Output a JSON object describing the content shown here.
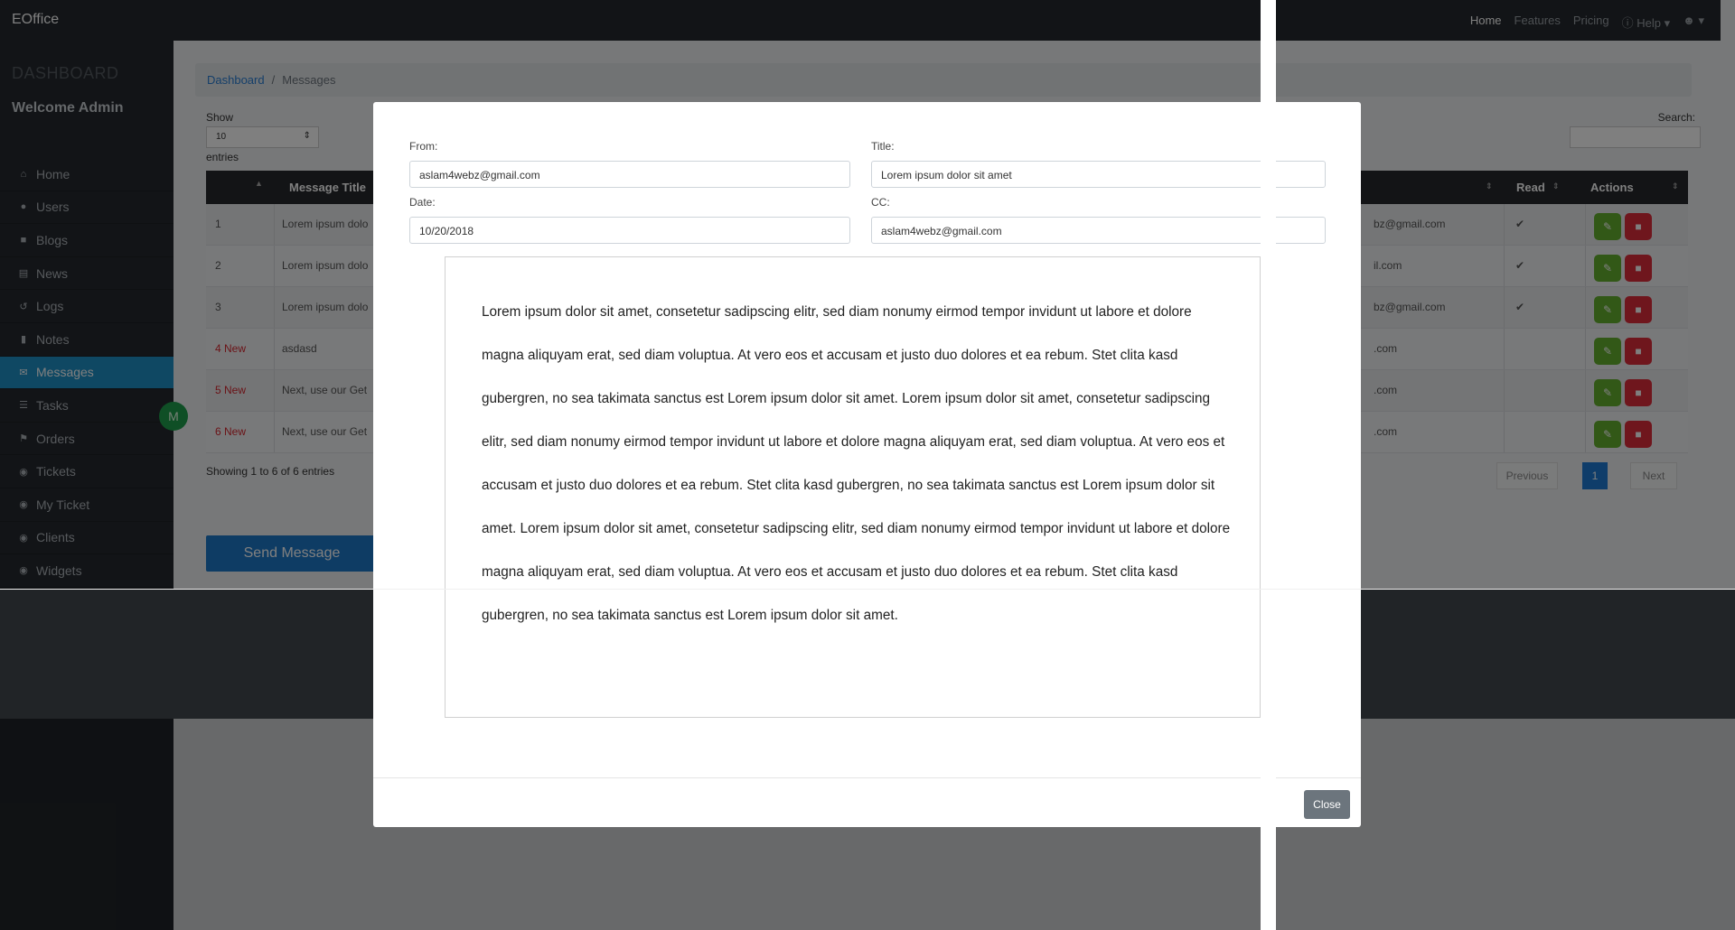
{
  "app": {
    "brand": "EOffice"
  },
  "topnav": {
    "home": "Home",
    "features": "Features",
    "pricing": "Pricing",
    "help": "Help",
    "help_caret": "▾",
    "account_caret": "▾"
  },
  "sidebar": {
    "title": "DASHBOARD",
    "welcome": "Welcome Admin",
    "items": [
      {
        "label": "Home",
        "icon": "home-icon"
      },
      {
        "label": "Users",
        "icon": "users-icon"
      },
      {
        "label": "Blogs",
        "icon": "blogs-icon"
      },
      {
        "label": "News",
        "icon": "news-icon"
      },
      {
        "label": "Logs",
        "icon": "logs-icon"
      },
      {
        "label": "Notes",
        "icon": "notes-icon"
      },
      {
        "label": "Messages",
        "icon": "messages-icon",
        "active": true
      },
      {
        "label": "Tasks",
        "icon": "tasks-icon"
      },
      {
        "label": "Orders",
        "icon": "orders-icon"
      },
      {
        "label": "Tickets",
        "icon": "tickets-icon"
      },
      {
        "label": "My Ticket",
        "icon": "my-ticket-icon"
      },
      {
        "label": "Clients",
        "icon": "clients-icon"
      },
      {
        "label": "Widgets",
        "icon": "widgets-icon"
      }
    ],
    "avatar_initial": "M"
  },
  "breadcrumb": {
    "root": "Dashboard",
    "separator": "/",
    "current": "Messages"
  },
  "table_controls": {
    "show": "Show",
    "length": "10",
    "entries": "entries",
    "search": "Search:"
  },
  "table": {
    "headers": {
      "title": "Message Title",
      "read": "Read",
      "actions": "Actions"
    },
    "rows": [
      {
        "id": "1",
        "title": "Lorem ipsum dolo",
        "email": "bz@gmail.com",
        "read": "✔"
      },
      {
        "id": "2",
        "title": "Lorem ipsum dolo",
        "email": "il.com",
        "read": "✔"
      },
      {
        "id": "3",
        "title": "Lorem ipsum dolo",
        "email": "bz@gmail.com",
        "read": "✔"
      },
      {
        "id": "4 New",
        "title": "asdasd",
        "email": ".com",
        "read": ""
      },
      {
        "id": "5 New",
        "title": "Next, use our Get",
        "email": ".com",
        "read": ""
      },
      {
        "id": "6 New",
        "title": "Next, use our Get",
        "email": ".com",
        "read": ""
      }
    ]
  },
  "table_footer": {
    "showing": "Showing 1 to 6 of 6 entries",
    "previous": "Previous",
    "page": "1",
    "next": "Next"
  },
  "send_button": "Send Message",
  "modal": {
    "from_label": "From:",
    "from_value": "aslam4webz@gmail.com",
    "title_label": "Title:",
    "title_value": "Lorem ipsum dolor sit amet",
    "date_label": "Date:",
    "date_value": "10/20/2018",
    "cc_label": "CC:",
    "cc_value": "aslam4webz@gmail.com",
    "body": "Lorem ipsum dolor sit amet, consetetur sadipscing elitr, sed diam nonumy eirmod tempor invidunt ut labore et dolore magna aliquyam erat, sed diam voluptua. At vero eos et accusam et justo duo dolores et ea rebum. Stet clita kasd gubergren, no sea takimata sanctus est Lorem ipsum dolor sit amet. Lorem ipsum dolor sit amet, consetetur sadipscing elitr, sed diam nonumy eirmod tempor invidunt ut labore et dolore magna aliquyam erat, sed diam voluptua. At vero eos et accusam et justo duo dolores et ea rebum. Stet clita kasd gubergren, no sea takimata sanctus est Lorem ipsum dolor sit amet. Lorem ipsum dolor sit amet, consetetur sadipscing elitr, sed diam nonumy eirmod tempor invidunt ut labore et dolore magna aliquyam erat, sed diam voluptua. At vero eos et accusam et justo duo dolores et ea rebum. Stet clita kasd gubergren, no sea takimata sanctus est Lorem ipsum dolor sit amet.",
    "close": "Close"
  }
}
